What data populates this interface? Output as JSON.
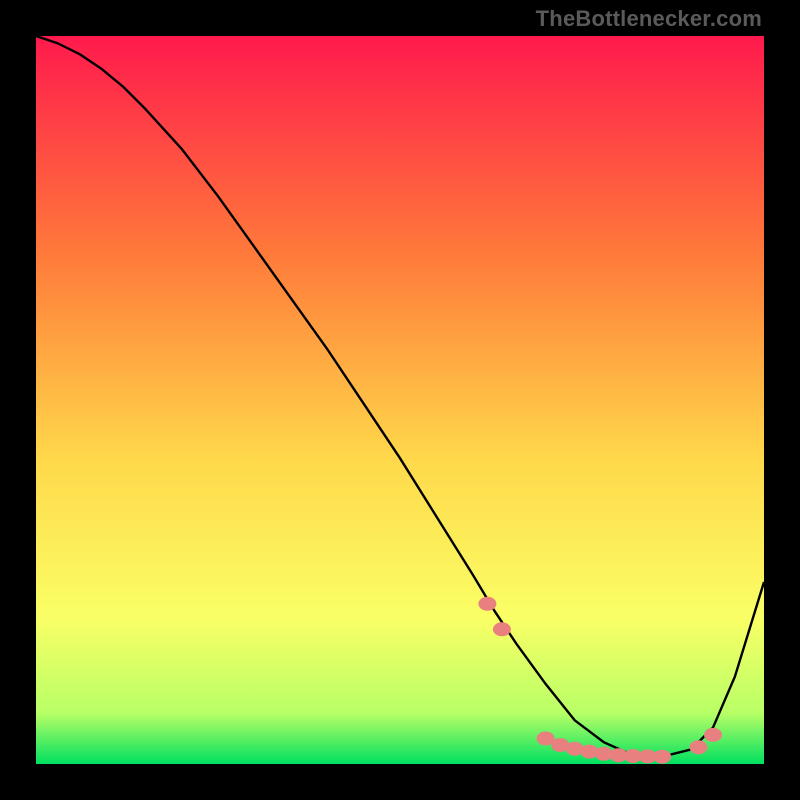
{
  "attribution": "TheBottlenecker.com",
  "colors": {
    "gradient_top": "#ff1a4d",
    "gradient_mid_upper": "#ff7a3a",
    "gradient_mid": "#ffd84a",
    "gradient_mid_lower": "#faff66",
    "gradient_lower": "#b8ff66",
    "gradient_bottom": "#00e060",
    "curve": "#000000",
    "marker": "#e98080"
  },
  "chart_data": {
    "type": "line",
    "title": "",
    "xlabel": "",
    "ylabel": "",
    "xlim": [
      0,
      100
    ],
    "ylim": [
      0,
      100
    ],
    "series": [
      {
        "name": "curve",
        "x": [
          0,
          3,
          6,
          9,
          12,
          15,
          20,
          25,
          30,
          35,
          40,
          45,
          50,
          55,
          60,
          63,
          66,
          70,
          74,
          78,
          82,
          86,
          90,
          93,
          96,
          100
        ],
        "y": [
          100,
          99,
          97.5,
          95.5,
          93,
          90,
          84.5,
          78,
          71,
          64,
          57,
          49.5,
          42,
          34,
          26,
          21,
          16.5,
          11,
          6,
          3,
          1.2,
          1.0,
          2.0,
          5,
          12,
          25
        ]
      }
    ],
    "markers": {
      "x": [
        62,
        64,
        70,
        72,
        74,
        76,
        78,
        80,
        82,
        84,
        86,
        91,
        93
      ],
      "y": [
        22,
        18.5,
        3.5,
        2.6,
        2.1,
        1.7,
        1.4,
        1.2,
        1.1,
        1.05,
        1.0,
        2.3,
        4.0
      ]
    }
  }
}
